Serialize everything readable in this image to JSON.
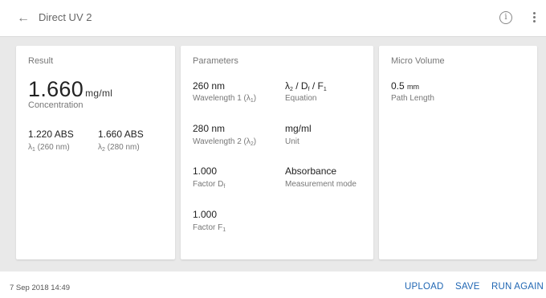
{
  "header": {
    "back_icon": "back-arrow-icon",
    "title": "Direct UV 2",
    "info_icon": "info-icon",
    "more_icon": "more-vert-icon"
  },
  "result": {
    "heading": "Result",
    "concentration_value": "1.660",
    "concentration_unit": "mg/ml",
    "concentration_label": "Concentration",
    "abs1_value": "1.220 ABS",
    "abs1_label_prefix": "λ",
    "abs1_label_sub": "1",
    "abs1_label_suffix": " (260 nm)",
    "abs2_value": "1.660 ABS",
    "abs2_label_prefix": "λ",
    "abs2_label_sub": "2",
    "abs2_label_suffix": " (280 nm)"
  },
  "parameters": {
    "heading": "Parameters",
    "wl1_value": "260 nm",
    "wl1_label_prefix": "Wavelength 1 (λ",
    "wl1_label_sub": "1",
    "wl1_label_suffix": ")",
    "equation_value_a": "λ",
    "equation_value_a_sub": "2",
    "equation_value_b": " / D",
    "equation_value_b_sub": "f",
    "equation_value_c": " / F",
    "equation_value_c_sub": "1",
    "equation_label": "Equation",
    "wl2_value": "280 nm",
    "wl2_label_prefix": "Wavelength 2 (λ",
    "wl2_label_sub": "2",
    "wl2_label_suffix": ")",
    "unit_value": "mg/ml",
    "unit_label": "Unit",
    "factor_d_value": "1.000",
    "factor_d_label_prefix": "Factor D",
    "factor_d_label_sub": "f",
    "mode_value": "Absorbance",
    "mode_label": "Measurement mode",
    "factor_f_value": "1.000",
    "factor_f_label_prefix": "Factor F",
    "factor_f_label_sub": "1"
  },
  "micro_volume": {
    "heading": "Micro Volume",
    "path_value": "0.5",
    "path_unit": "mm",
    "path_label": "Path Length"
  },
  "footer": {
    "date": "7 Sep 2018 14:49",
    "upload_label": "UPLOAD",
    "save_label": "SAVE",
    "run_again_label": "RUN AGAIN"
  },
  "colors": {
    "accent": "#1f66b3",
    "background": "#e9e9e9",
    "card": "#ffffff"
  }
}
